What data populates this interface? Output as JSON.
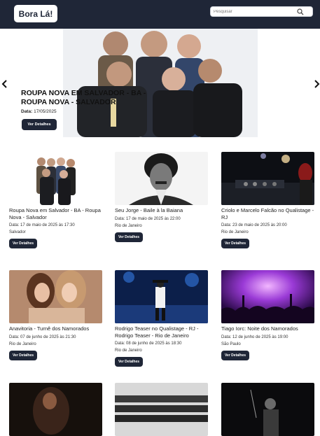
{
  "header": {
    "logo": "Bora Lá!",
    "search_placeholder": "Pesquisar"
  },
  "hero": {
    "title": "ROUPA NOVA EM SALVADOR - BA - ROUPA NOVA - SALVADOR",
    "date_label": "Data:",
    "date_value": "17/05/2025",
    "button": "Ver Detalhes"
  },
  "events": [
    {
      "title": "Roupa Nova em Salvador - BA - Roupa Nova - Salvador",
      "date": "Data: 17 de maio de 2025 às 17:30",
      "city": "Salvador",
      "button": "Ver Detalhes"
    },
    {
      "title": "Seu Jorge - Baile à la Baiana",
      "date": "Data: 17 de maio de 2025 às 22:00",
      "city": "Rio de Janeiro",
      "button": "Ver Detalhes"
    },
    {
      "title": "Criolo e Marcelo Falcão no Qualistage - RJ",
      "date": "Data: 23 de maio de 2025 às 20:00",
      "city": "Rio de Janeiro",
      "button": "Ver Detalhes"
    },
    {
      "title": "Anavitoria - Turnê dos Namorados",
      "date": "Data: 07 de junho de 2025 às 21:30",
      "city": "Rio de Janeiro",
      "button": "Ver Detalhes"
    },
    {
      "title": "Rodrigo Teaser no Qualistage - RJ - Rodrigo Teaser - Rio de Janeiro",
      "date": "Data: 08 de junho de 2025 às 18:30",
      "city": "Rio de Janeiro",
      "button": "Ver Detalhes"
    },
    {
      "title": "Tiago Iorc: Noite dos Namorados",
      "date": "Data: 12 de junho de 2025 às 19:00",
      "city": "São Paulo",
      "button": "Ver Detalhes"
    }
  ],
  "colors": {
    "header_bg": "#1f2637",
    "button_bg": "#1f2637",
    "page_bg": "#ffffff"
  },
  "icons": [
    "search-icon",
    "chevron-left-icon",
    "chevron-right-icon"
  ]
}
